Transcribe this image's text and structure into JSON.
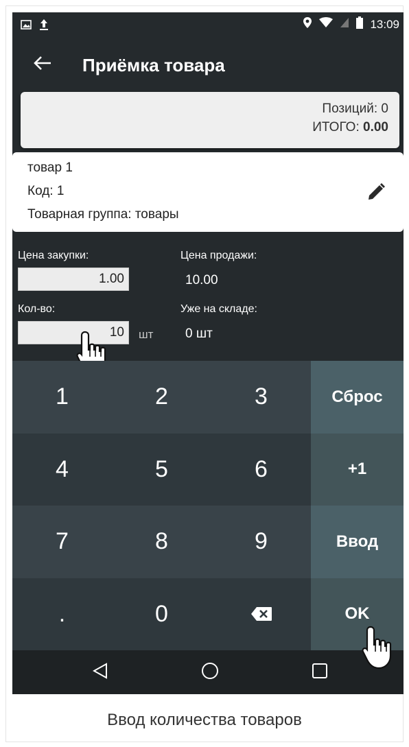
{
  "status_bar": {
    "time": "13:09"
  },
  "app_bar": {
    "title": "Приёмка товара"
  },
  "totals": {
    "positions_label": "Позиций: 0",
    "total_label": "ИТОГО:",
    "total_value": "0.00"
  },
  "product": {
    "name": "товар 1",
    "code": "Код: 1",
    "group": "Товарная группа: товары"
  },
  "purchase_price": {
    "label": "Цена закупки:",
    "value": "1.00"
  },
  "sale_price": {
    "label": "Цена продажи:",
    "value": "10.00"
  },
  "quantity": {
    "label": "Кол-во:",
    "value": "10",
    "unit": "шт"
  },
  "in_stock": {
    "label": "Уже на складе:",
    "value": "0 шт"
  },
  "keypad": {
    "k1": "1",
    "k2": "2",
    "k3": "3",
    "reset": "Сброс",
    "k4": "4",
    "k5": "5",
    "k6": "6",
    "plus_one": "+1",
    "k7": "7",
    "k8": "8",
    "k9": "9",
    "enter": "Ввод",
    "dot": ".",
    "k0": "0",
    "ok": "OK"
  },
  "caption": "Ввод количества товаров",
  "icons": [
    "image-icon",
    "upload-icon",
    "location-icon",
    "wifi-icon",
    "signal-icon",
    "battery-icon",
    "back-arrow-icon",
    "pencil-icon",
    "backspace-icon",
    "nav-back-icon",
    "nav-home-icon",
    "nav-recents-icon",
    "pointer-hand-icon"
  ]
}
